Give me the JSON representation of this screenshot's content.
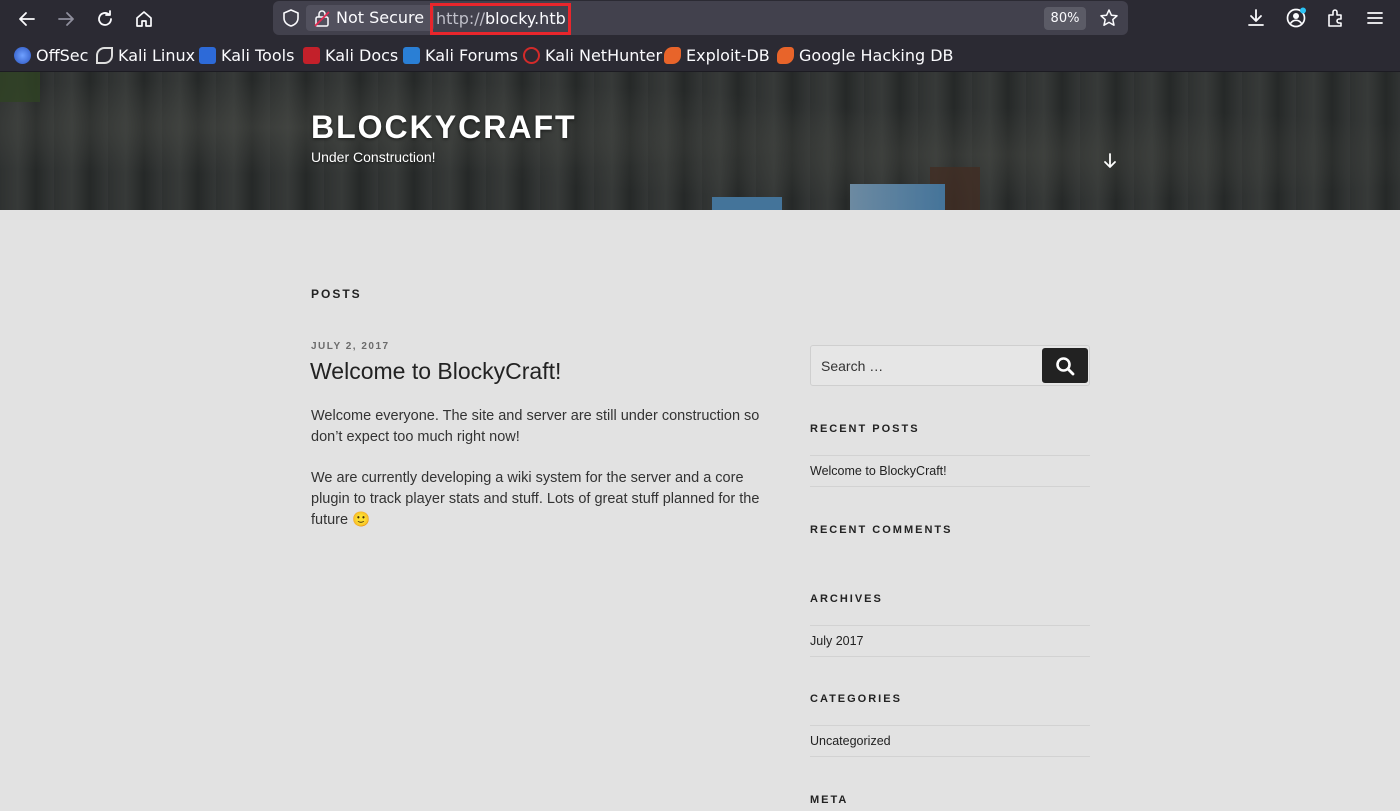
{
  "browser": {
    "not_secure_label": "Not Secure",
    "url_protocol": "http://",
    "url_host": "blocky.htb",
    "zoom": "80%",
    "bookmarks": [
      {
        "label": "OffSec",
        "icon": "offsec-icon",
        "color": "#3b6fd1"
      },
      {
        "label": "Kali Linux",
        "icon": "kali-dragon-icon",
        "color": "#111111"
      },
      {
        "label": "Kali Tools",
        "icon": "kali-tools-icon",
        "color": "#2d6ad8"
      },
      {
        "label": "Kali Docs",
        "icon": "kali-docs-icon",
        "color": "#c3202a"
      },
      {
        "label": "Kali Forums",
        "icon": "kali-forums-icon",
        "color": "#2a7fd5"
      },
      {
        "label": "Kali NetHunter",
        "icon": "nethunter-icon",
        "color": "#d22a2a"
      },
      {
        "label": "Exploit-DB",
        "icon": "exploitdb-icon",
        "color": "#e8642a"
      },
      {
        "label": "Google Hacking DB",
        "icon": "ghdb-icon",
        "color": "#e8642a"
      }
    ]
  },
  "site": {
    "title": "BLOCKYCRAFT",
    "description": "Under Construction!"
  },
  "main": {
    "posts_heading": "POSTS",
    "post": {
      "date": "JULY 2, 2017",
      "title": "Welcome to BlockyCraft!",
      "paragraphs": [
        "Welcome everyone. The site and server are still under construction so don’t expect too much right now!",
        "We are currently developing a wiki system for the server and a core plugin to track player stats and stuff. Lots of great stuff planned for the future 🙂"
      ]
    }
  },
  "sidebar": {
    "search_placeholder": "Search …",
    "recent_posts_title": "RECENT POSTS",
    "recent_posts": [
      "Welcome to BlockyCraft!"
    ],
    "recent_comments_title": "RECENT COMMENTS",
    "archives_title": "ARCHIVES",
    "archives": [
      "July 2017"
    ],
    "categories_title": "CATEGORIES",
    "categories": [
      "Uncategorized"
    ],
    "meta_title": "META"
  }
}
